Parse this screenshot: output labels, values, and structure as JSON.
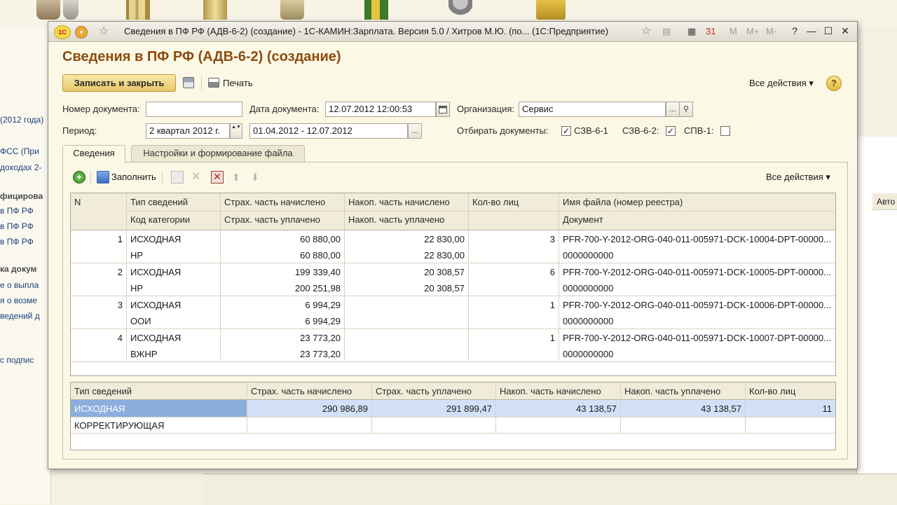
{
  "background": {
    "left_items": [
      "(2012 года)",
      "ФСС (При",
      "доходах 2-",
      "фицирова",
      "в ПФ РФ",
      "в ПФ РФ",
      "в ПФ РФ",
      "ка докум",
      "е о выпла",
      "я о возме",
      "ведений д",
      "с подпис"
    ],
    "right_header": "Авто"
  },
  "window": {
    "title": "Сведения в ПФ РФ (АДВ-6-2) (создание) - 1С-КАМИН:Зарплата. Версия 5.0 / Хитров М.Ю. (по...  (1С:Предприятие)",
    "logo": "1С",
    "calc_tools": [
      "M",
      "M+",
      "M-"
    ]
  },
  "doc": {
    "title": "Сведения в ПФ РФ (АДВ-6-2) (создание)",
    "save_close": "Записать и закрыть",
    "print": "Печать",
    "all_actions": "Все действия",
    "help": "?"
  },
  "form": {
    "doc_number_label": "Номер документа:",
    "doc_number_value": "",
    "doc_date_label": "Дата документа:",
    "doc_date_value": "12.07.2012 12:00:53",
    "org_label": "Организация:",
    "org_value": "Сервис",
    "period_label": "Период:",
    "period_value": "2 квартал 2012 г.",
    "period_range": "01.04.2012 - 12.07.2012",
    "select_label": "Отбирать документы:",
    "szv61_label": "СЗВ-6-1",
    "szv61_checked": true,
    "szv62_label": "СЗВ-6-2:",
    "szv62_checked": true,
    "spv1_label": "СПВ-1:",
    "spv1_checked": false,
    "ellipsis": "...",
    "spin": "▲▼"
  },
  "tabs": [
    {
      "label": "Сведения",
      "active": true
    },
    {
      "label": "Настройки и формирование файла",
      "active": false
    }
  ],
  "commands": {
    "fill": "Заполнить",
    "all_actions": "Все действия"
  },
  "main_table": {
    "header_row1": [
      "N",
      "Тип сведений",
      "Страх. часть начислено",
      "Накоп. часть начислено",
      "Кол-во лиц",
      "Имя файла (номер реестра)"
    ],
    "header_row2": [
      "",
      "Код категории",
      "Страх. часть уплачено",
      "Накоп. часть уплачено",
      "",
      "Документ"
    ],
    "rows": [
      {
        "n": "1",
        "type": "ИСХОДНАЯ",
        "cat": "НР",
        "ins_acc": "60 880,00",
        "ins_paid": "60 880,00",
        "fund_acc": "22 830,00",
        "fund_paid": "22 830,00",
        "count": "3",
        "file": "PFR-700-Y-2012-ORG-040-011-005971-DCK-10004-DPT-00000...",
        "doc": "0000000000"
      },
      {
        "n": "2",
        "type": "ИСХОДНАЯ",
        "cat": "НР",
        "ins_acc": "199 339,40",
        "ins_paid": "200 251,98",
        "fund_acc": "20 308,57",
        "fund_paid": "20 308,57",
        "count": "6",
        "file": "PFR-700-Y-2012-ORG-040-011-005971-DCK-10005-DPT-00000...",
        "doc": "0000000000"
      },
      {
        "n": "3",
        "type": "ИСХОДНАЯ",
        "cat": "ООИ",
        "ins_acc": "6 994,29",
        "ins_paid": "6 994,29",
        "fund_acc": "",
        "fund_paid": "",
        "count": "1",
        "file": "PFR-700-Y-2012-ORG-040-011-005971-DCK-10006-DPT-00000...",
        "doc": "0000000000"
      },
      {
        "n": "4",
        "type": "ИСХОДНАЯ",
        "cat": "ВЖНР",
        "ins_acc": "23 773,20",
        "ins_paid": "23 773,20",
        "fund_acc": "",
        "fund_paid": "",
        "count": "1",
        "file": "PFR-700-Y-2012-ORG-040-011-005971-DCK-10007-DPT-00000...",
        "doc": "0000000000"
      }
    ]
  },
  "summary_table": {
    "headers": [
      "Тип сведений",
      "Страх. часть начислено",
      "Страх. часть уплачено",
      "Накоп. часть начислено",
      "Накоп. часть уплачено",
      "Кол-во лиц"
    ],
    "rows": [
      [
        "ИСХОДНАЯ",
        "290 986,89",
        "291 899,47",
        "43 138,57",
        "43 138,57",
        "11"
      ],
      [
        "КОРРЕКТИРУЮЩАЯ",
        "",
        "",
        "",
        "",
        ""
      ]
    ]
  }
}
